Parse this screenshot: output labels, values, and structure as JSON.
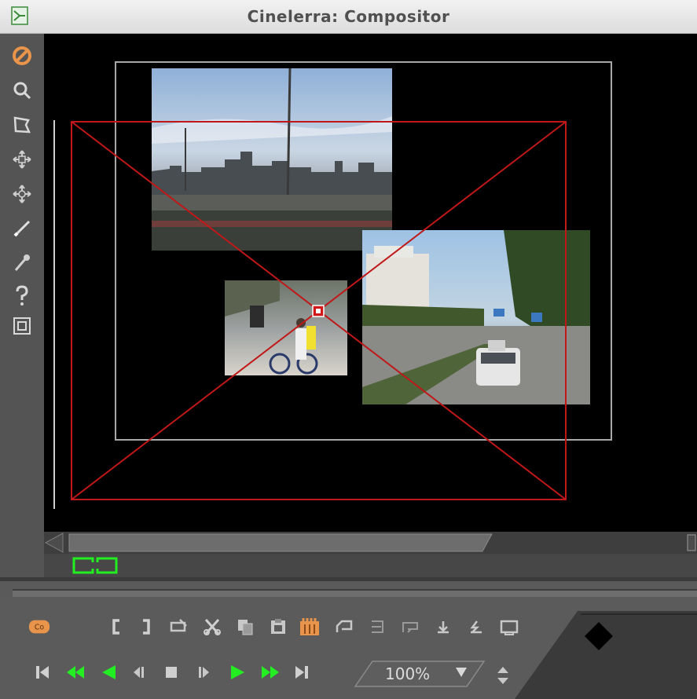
{
  "window": {
    "title": "Cinelerra: Compositor"
  },
  "left_toolbar": {
    "tools": [
      {
        "name": "protect-icon"
      },
      {
        "name": "zoom-icon"
      },
      {
        "name": "mask-icon"
      },
      {
        "name": "camera-icon"
      },
      {
        "name": "projector-icon"
      },
      {
        "name": "crop-icon"
      },
      {
        "name": "eyedropper-icon"
      },
      {
        "name": "help-icon"
      },
      {
        "name": "safe-region-icon"
      }
    ]
  },
  "transport": {
    "edit_buttons": [
      "label-icon",
      "in-point-icon",
      "out-point-icon",
      "splice-icon",
      "cut-icon",
      "copy-icon",
      "paste-icon",
      "clip-icon",
      "prev-label-icon",
      "next-label-icon",
      "prev-edit-icon",
      "next-edit-icon",
      "overwrite-icon",
      "toggle-icon"
    ],
    "play_buttons": [
      "rewind-icon",
      "fast-reverse-icon",
      "reverse-icon",
      "frame-reverse-icon",
      "stop-icon",
      "frame-forward-icon",
      "play-icon",
      "fast-forward-icon",
      "jump-end-icon"
    ],
    "zoom_value": "100%"
  },
  "colors": {
    "accent_green": "#22ee22",
    "mask_red": "#c01818",
    "projector_gray": "#a8a8a8",
    "protect_orange": "#e8944a"
  }
}
